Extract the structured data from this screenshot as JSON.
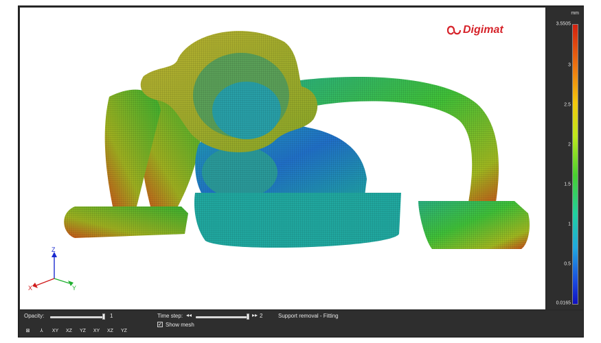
{
  "viewer": {
    "logo_text": "Digimat",
    "unit": "mm",
    "colorbar": {
      "max": "3.5505",
      "min": "0.0165",
      "ticks": [
        "3",
        "2.5",
        "2",
        "1.5",
        "1",
        "0.5"
      ]
    },
    "axes": {
      "z": "Z",
      "x": "X",
      "y": "Y"
    }
  },
  "controls": {
    "opacity_label": "Opacity:",
    "opacity_value": "1",
    "timestep_label": "Time step:",
    "timestep_value": "2",
    "status_text": "Support removal - Fitting",
    "show_mesh_label": "Show mesh",
    "show_mesh_checked": "✓"
  },
  "toolbar": {
    "icons": [
      {
        "name": "fit-view-icon",
        "glyph": "⊠"
      },
      {
        "name": "iso-view-icon",
        "glyph": "⅄"
      },
      {
        "name": "view-xy-icon",
        "glyph": "XY"
      },
      {
        "name": "view-xz-icon",
        "glyph": "XZ"
      },
      {
        "name": "view-yz-icon",
        "glyph": "YZ"
      },
      {
        "name": "view-neg-xy-icon",
        "glyph": "XY"
      },
      {
        "name": "view-neg-xz-icon",
        "glyph": "XZ"
      },
      {
        "name": "view-neg-yz-icon",
        "glyph": "YZ"
      }
    ]
  },
  "colors": {
    "brand_red": "#d6232a",
    "panel_dark": "#2e2e2e"
  }
}
